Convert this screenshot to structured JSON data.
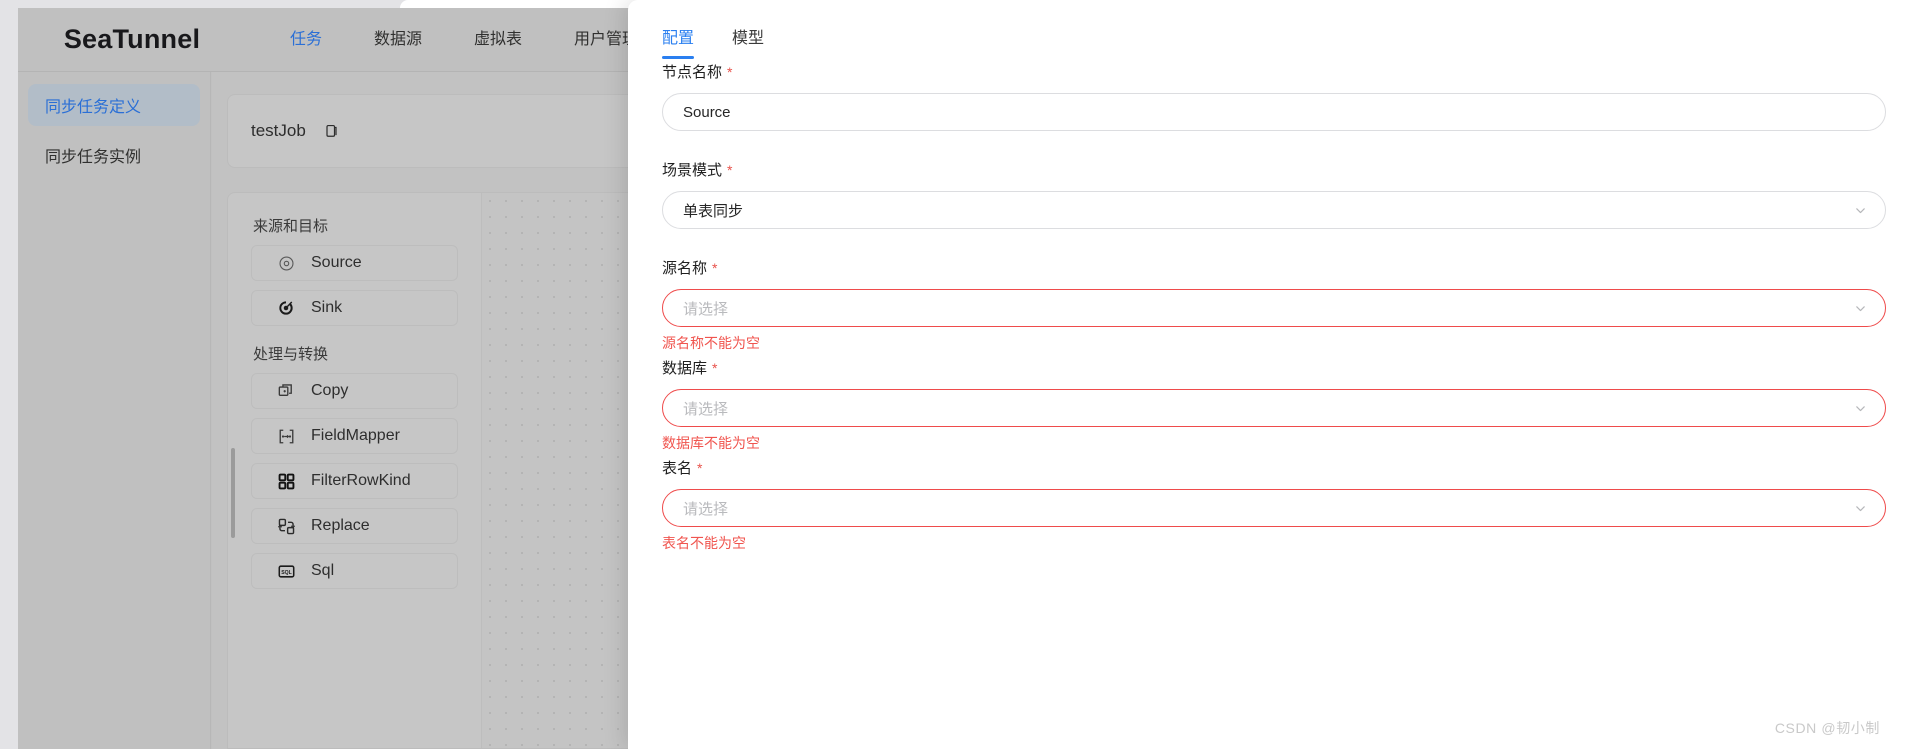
{
  "app": {
    "brand": "SeaTunnel",
    "top_nav": [
      {
        "label": "任务",
        "active": true
      },
      {
        "label": "数据源",
        "active": false
      },
      {
        "label": "虚拟表",
        "active": false
      },
      {
        "label": "用户管理",
        "active": false
      }
    ],
    "sidebar": [
      {
        "label": "同步任务定义",
        "active": true
      },
      {
        "label": "同步任务实例",
        "active": false
      }
    ],
    "job": {
      "title": "testJob",
      "copy_icon": "copy-icon"
    },
    "palette": {
      "group1_title": "来源和目标",
      "group1_items": [
        {
          "label": "Source",
          "icon": "target-circle-icon"
        },
        {
          "label": "Sink",
          "icon": "sink-target-icon"
        }
      ],
      "group2_title": "处理与转换",
      "group2_items": [
        {
          "label": "Copy",
          "icon": "copy-square-icon"
        },
        {
          "label": "FieldMapper",
          "icon": "field-mapper-icon"
        },
        {
          "label": "FilterRowKind",
          "icon": "grid-four-icon"
        },
        {
          "label": "Replace",
          "icon": "replace-icon"
        },
        {
          "label": "Sql",
          "icon": "sql-icon"
        }
      ]
    }
  },
  "drawer": {
    "tabs": [
      {
        "label": "配置",
        "active": true
      },
      {
        "label": "模型",
        "active": false
      }
    ],
    "fields": {
      "node_name": {
        "label": "节点名称",
        "required": "*",
        "value": "Source"
      },
      "scene_mode": {
        "label": "场景模式",
        "required": "*",
        "value": "单表同步",
        "chevron": "chevron-down-icon"
      },
      "source_name": {
        "label": "源名称",
        "required": "*",
        "placeholder": "请选择",
        "error": "源名称不能为空",
        "chevron": "chevron-down-icon"
      },
      "database": {
        "label": "数据库",
        "required": "*",
        "placeholder": "请选择",
        "error": "数据库不能为空",
        "chevron": "chevron-down-icon"
      },
      "table_name": {
        "label": "表名",
        "required": "*",
        "placeholder": "请选择",
        "error": "表名不能为空",
        "chevron": "chevron-down-icon"
      }
    }
  },
  "watermark": "CSDN @韧小制",
  "colors": {
    "accent": "#2a7ff0",
    "error": "#ef4b4b",
    "nav_active": "#2a6fd6",
    "panel_bg": "#ffffff",
    "dim_bg": "#c0c0c0"
  }
}
